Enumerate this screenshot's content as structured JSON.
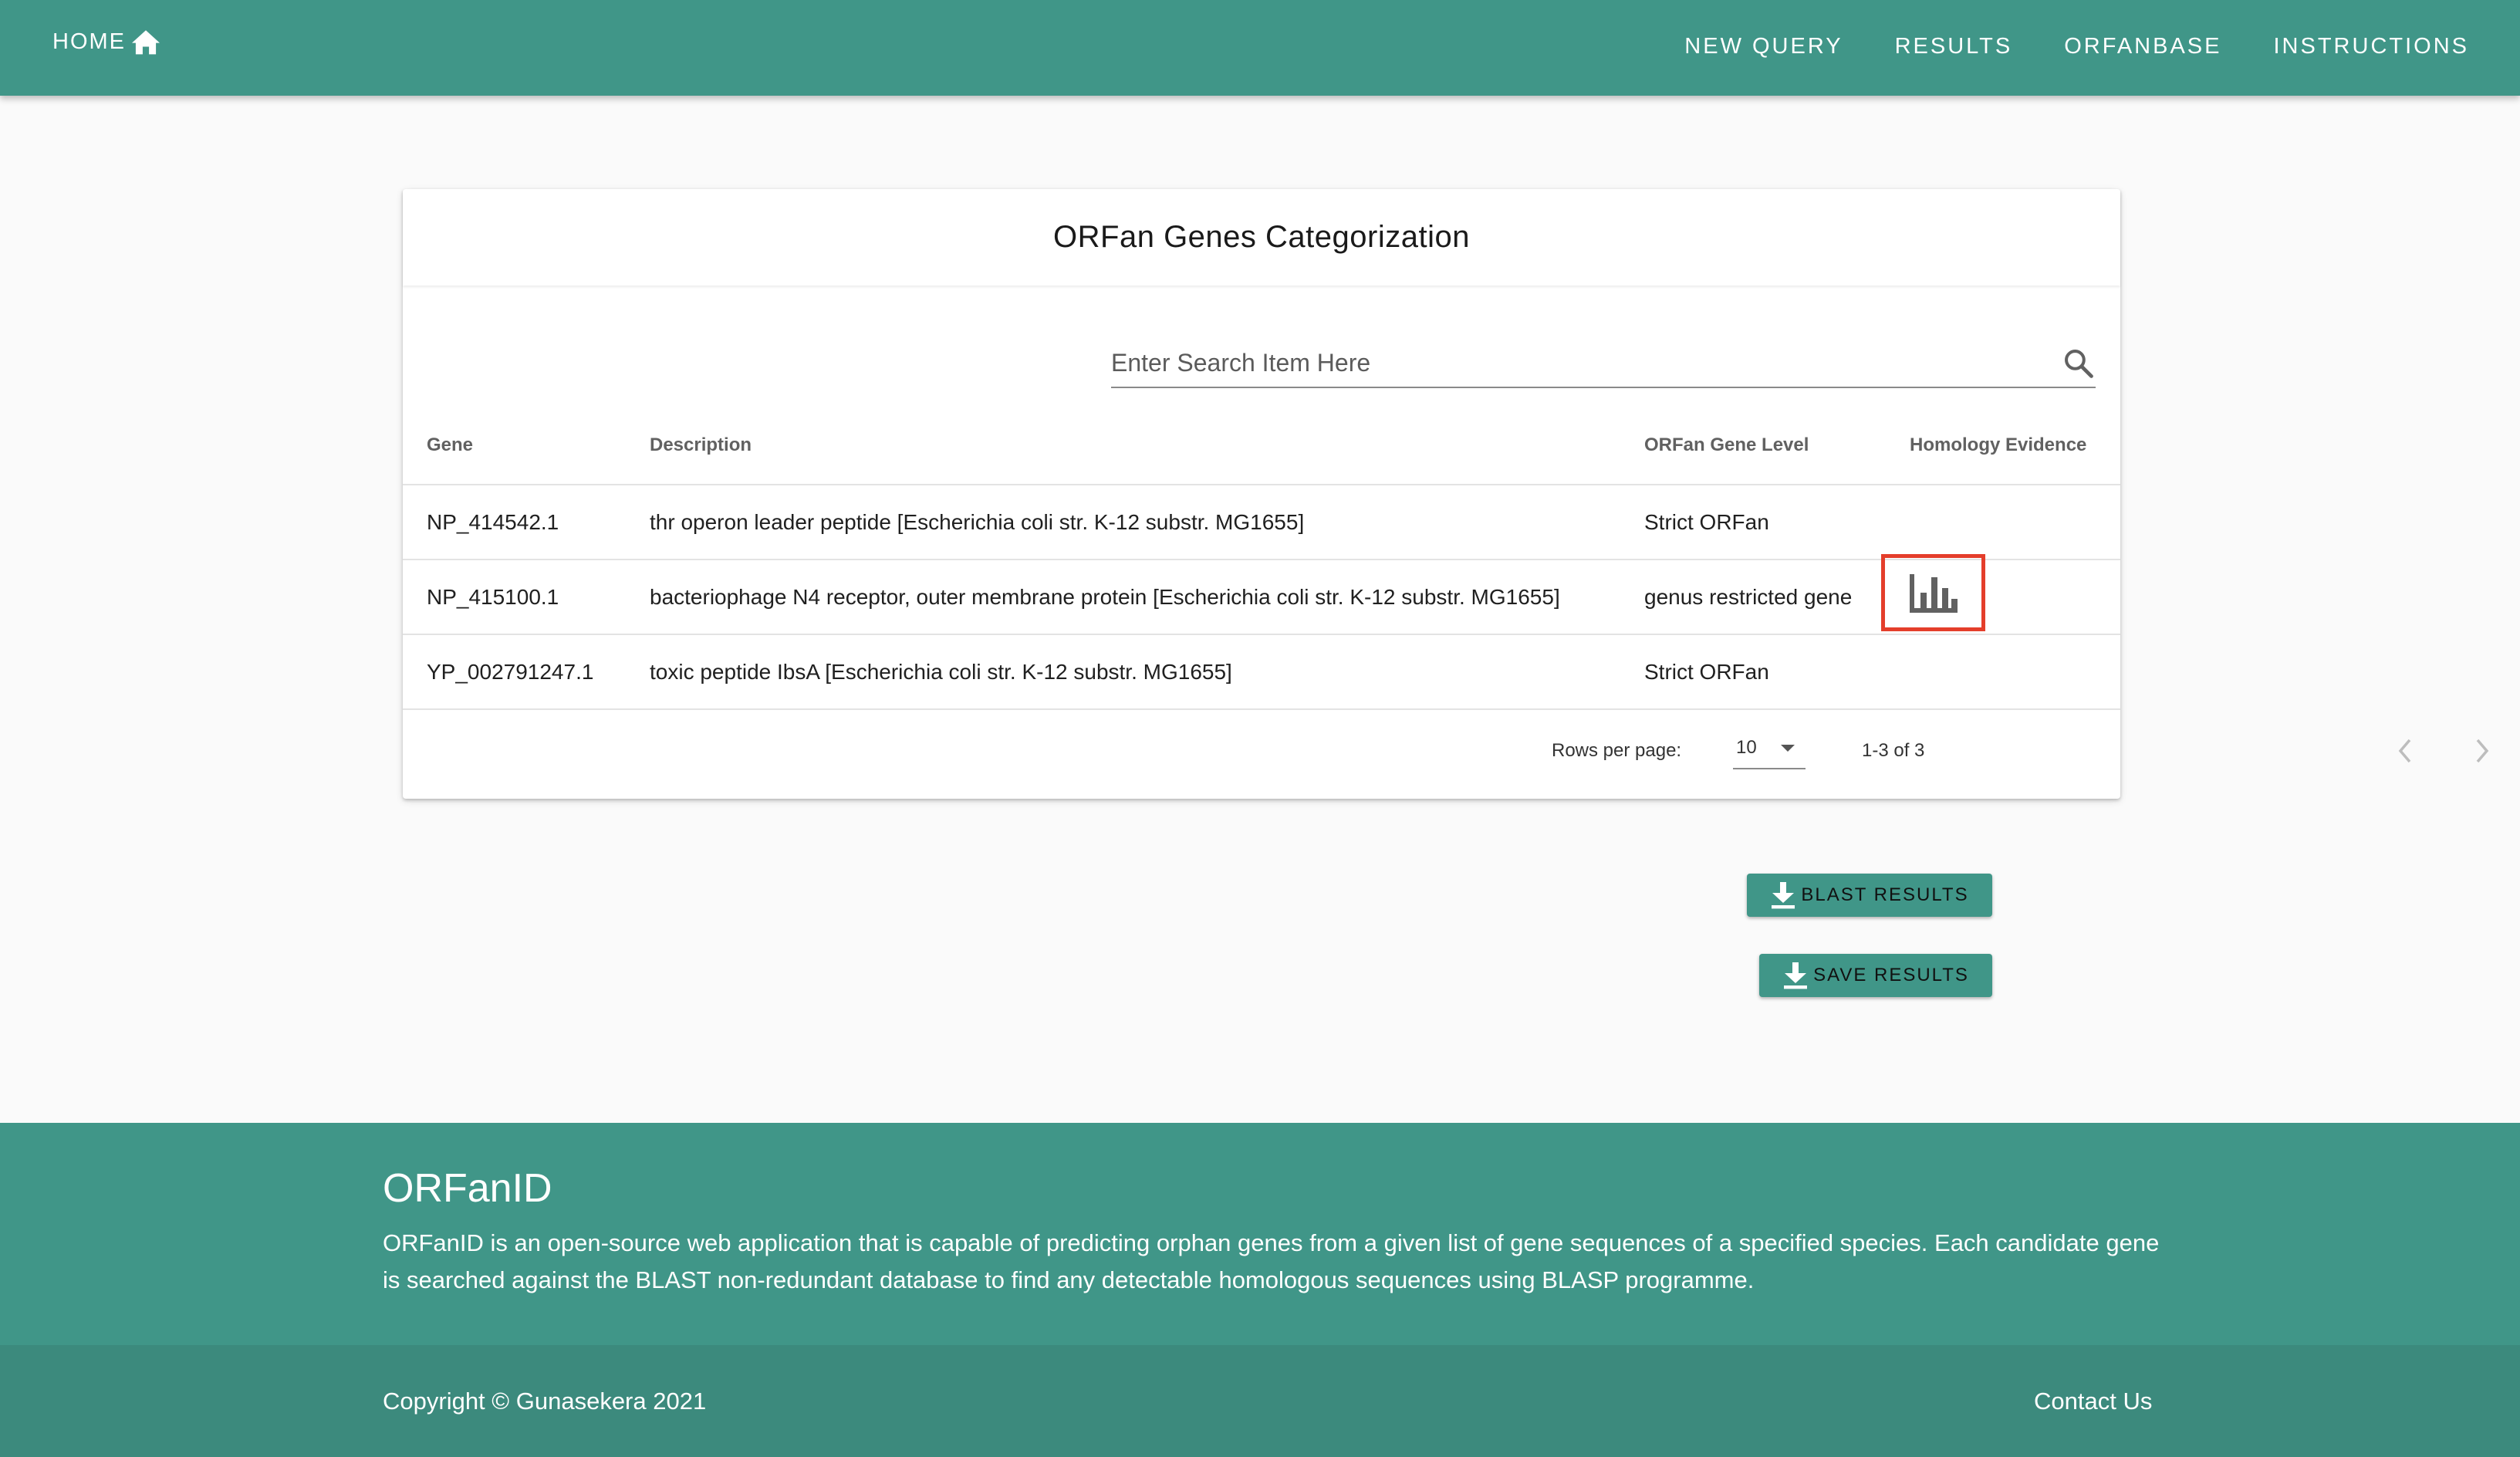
{
  "nav": {
    "home_label": "HOME",
    "links": [
      "NEW QUERY",
      "RESULTS",
      "ORFANBASE",
      "INSTRUCTIONS"
    ]
  },
  "card": {
    "title": "ORFan Genes Categorization",
    "search_placeholder": "Enter Search Item Here",
    "columns": [
      "Gene",
      "Description",
      "ORFan Gene Level",
      "Homology Evidence"
    ],
    "rows": [
      {
        "gene": "NP_414542.1",
        "description": "thr operon leader peptide [Escherichia coli str. K-12 substr. MG1655]",
        "level": "Strict ORFan"
      },
      {
        "gene": "NP_415100.1",
        "description": "bacteriophage N4 receptor, outer membrane protein [Escherichia coli str. K-12 substr. MG1655]",
        "level": "genus restricted gene",
        "homology_icon": "bar-chart-icon"
      },
      {
        "gene": "YP_002791247.1",
        "description": "toxic peptide IbsA [Escherichia coli str. K-12 substr. MG1655]",
        "level": "Strict ORFan"
      }
    ],
    "pagination": {
      "rows_per_page_label": "Rows per page:",
      "rows_per_page": "10",
      "range": "1-3 of 3"
    }
  },
  "actions": {
    "blast_label": "BLAST RESULTS",
    "save_label": "SAVE RESULTS"
  },
  "footer": {
    "title": "ORFanID",
    "description": "ORFanID is an open-source web application that is capable of predicting orphan genes from a given list of gene sequences of a specified species. Each candidate gene is searched against the BLAST non-redundant database to find any detectable homologous sequences using BLASP programme.",
    "copyright": "Copyright  © Gunasekera 2021",
    "contact": "Contact Us"
  },
  "colors": {
    "primary": "#409688",
    "highlight": "#e43e2b"
  }
}
